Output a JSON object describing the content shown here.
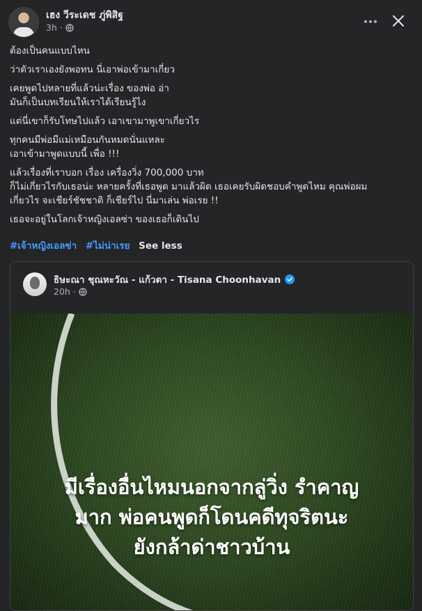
{
  "post": {
    "author": "เฮง วีระเดช ภู่พิสิฐ",
    "time": "3h",
    "paragraphs": [
      [
        "ต้องเป็นคนแบบไหน"
      ],
      [
        "ว่าตัวเราเองยังพอทน นี่เอาพ่อเข้ามาเกี่ยว"
      ],
      [
        "เคยพูดไปหลายที่แล้วน่ะเรื่อง ของพ่อ อ่า",
        "มันก็เป็นบทเรียนให้เราได้เรียนรู้ไง"
      ],
      [
        "แต่นี่เขาก็รับโทษไปแล้ว เอาเขามาพูเขาเกี่ยวไร"
      ],
      [
        "ทุกคนมีพ่อมีแม่เหมือนกันหมดนั่นแหละ",
        "เอาเข้ามาพูดแบบนี้ เพื่อ !!!"
      ],
      [
        "แล้วเรื่องที่เราบอก เรื่อง เครื่องวิ่ง 700,000 บาท",
        " ก็ไม่เกี่ยวไรกับเธอน่ะ หลายครั้งที่เธอพูด มาแล้วผิด เธอเคยรับผิดชอบคำพูดไหม คุณพ่อผม",
        "เกี่ยวไร  จะเชียร์ชัชชาติ ก็เชียร์ไป นี่มาเล่น พ่อเรย  !!"
      ],
      [
        "เธอจะอยู่ในโลกเจ้าหญิงเอลซ่า ของเธอก็เดินไป"
      ]
    ],
    "tags": [
      "#เจ้าหญิงเอลซ่า",
      "#ไม่น่าเรย"
    ],
    "see_less": "See less"
  },
  "shared_post": {
    "author": "ธิษะณา ชุณหะวัณ - แก้วตา - Tisana Choonhavan",
    "time": "20h",
    "image_text": [
      "มีเรื่องอื่นไหมนอกจากลู่วิ่ง รำคาญ",
      "มาก พ่อคนพูดก็โดนคดีทุจริตนะ",
      "ยังกล้าด่าชาวบ้าน"
    ]
  },
  "icons": {
    "privacy": "globe-icon",
    "more": "more-options-icon",
    "close": "close-icon",
    "verified": "verified-badge-icon"
  },
  "colors": {
    "background": "#242526",
    "text": "#e4e6eb",
    "secondary_text": "#b0b3b8",
    "link": "#4599ff",
    "verified": "#1d9bf0"
  }
}
